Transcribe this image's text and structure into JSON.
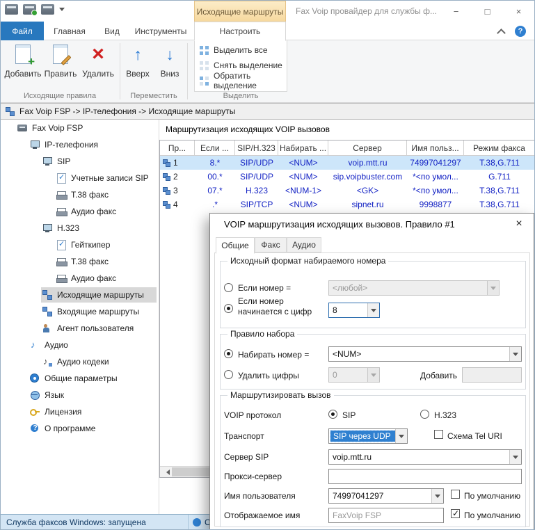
{
  "glyphs": {
    "minimize": "−",
    "maximize": "□",
    "close": "×",
    "dialog_close": "×",
    "help": "?"
  },
  "titlebar": {
    "context_header": "Исходящие маршруты",
    "title": "Fax Voip провайдер для службы ф..."
  },
  "ribbon": {
    "file_tab": "Файл",
    "tabs": [
      "Главная",
      "Вид",
      "Инструменты"
    ],
    "active_tab": "Настроить",
    "group_rules": {
      "label": "Исходящие правила",
      "add": "Добавить",
      "edit": "Править",
      "delete": "Удалить"
    },
    "group_move": {
      "label": "Переместить",
      "up": "Вверх",
      "down": "Вниз"
    },
    "group_select": {
      "label": "Выделить",
      "select_all": "Выделить все",
      "clear": "Снять выделение",
      "invert": "Обратить выделение"
    }
  },
  "breadcrumb": "Fax Voip FSP -> IP-телефония -> Исходящие маршруты",
  "tree": {
    "items": [
      {
        "label": "Fax Voip FSP"
      },
      {
        "label": "IP-телефония"
      },
      {
        "label": "SIP"
      },
      {
        "label": "Учетные записи SIP"
      },
      {
        "label": "Т.38 факс"
      },
      {
        "label": "Аудио факс"
      },
      {
        "label": "Н.323"
      },
      {
        "label": "Гейткипер"
      },
      {
        "label": "Т.38 факс"
      },
      {
        "label": "Аудио факс"
      },
      {
        "label": "Исходящие маршруты"
      },
      {
        "label": "Входящие маршруты"
      },
      {
        "label": "Агент пользователя"
      },
      {
        "label": "Аудио"
      },
      {
        "label": "Аудио кодеки"
      },
      {
        "label": "Общие параметры"
      },
      {
        "label": "Язык"
      },
      {
        "label": "Лицензия"
      },
      {
        "label": "О программе"
      }
    ]
  },
  "main": {
    "title": "Маршрутизация исходящих VOIP вызовов",
    "table": {
      "headers": [
        "Пр...",
        "Если ...",
        "SIP/H.323",
        "Набирать ...",
        "Сервер",
        "Имя польз...",
        "Режим факса"
      ],
      "rows": [
        {
          "num": "1",
          "cells": [
            "8.*",
            "SIP/UDP",
            "<NUM>",
            "voip.mtt.ru",
            "74997041297",
            "T.38,G.711"
          ]
        },
        {
          "num": "2",
          "cells": [
            "00.*",
            "SIP/UDP",
            "<NUM>",
            "sip.voipbuster.com",
            "*<по умол...",
            "G.711"
          ]
        },
        {
          "num": "3",
          "cells": [
            "07.*",
            "H.323",
            "<NUM-1>",
            "<GK>",
            "*<по умол...",
            "T.38,G.711"
          ]
        },
        {
          "num": "4",
          "cells": [
            ".*",
            "SIP/TCP",
            "<NUM>",
            "sipnet.ru",
            "9998877",
            "T.38,G.711"
          ]
        }
      ]
    }
  },
  "dialog": {
    "title": "VOIP маршрутизация исходящих вызовов. Правило #1",
    "tabs": [
      "Общие",
      "Факс",
      "Аудио"
    ],
    "group_format": {
      "label": "Исходный формат набираемого номера",
      "radio_equals": "Если номер =",
      "combo_any": "<любой>",
      "radio_starts": "Если номер начинается с цифр",
      "combo_digits": "8"
    },
    "group_dial": {
      "label": "Правило набора",
      "radio_dial": "Набирать номер =",
      "combo_num": "<NUM>",
      "radio_remove": "Удалить цифры",
      "combo_remove": "0",
      "add_label": "Добавить",
      "add_value": ""
    },
    "group_route": {
      "label": "Маршрутизировать вызов",
      "protocol_label": "VOIP протокол",
      "sip": "SIP",
      "h323": "H.323",
      "transport_label": "Транспорт",
      "transport_value": "SIP через UDP",
      "tel_uri": "Схема Tel URI",
      "server_label": "Сервер SIP",
      "server_value": "voip.mtt.ru",
      "proxy_label": "Прокси-сервер",
      "proxy_value": "",
      "username_label": "Имя пользователя",
      "username_value": "74997041297",
      "default1": "По умолчанию",
      "display_label": "Отображаемое имя",
      "display_value": "FaxVoip FSP",
      "default2": "По умолчанию"
    }
  },
  "statusbar": {
    "service": "Служба факсов Windows: запущена",
    "second": "Служ"
  }
}
